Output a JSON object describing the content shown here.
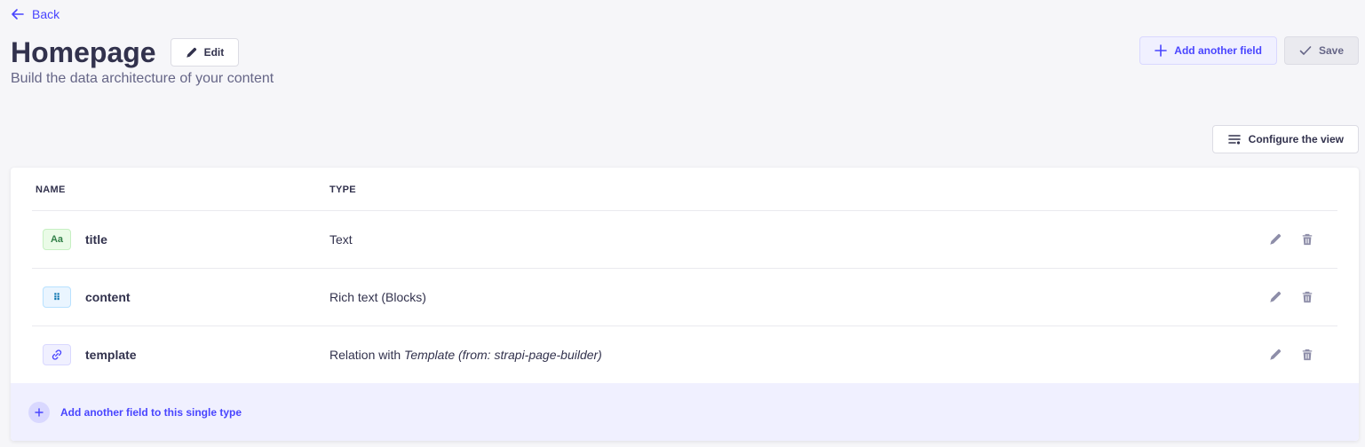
{
  "nav": {
    "back_label": "Back"
  },
  "header": {
    "title": "Homepage",
    "edit_label": "Edit",
    "subtitle": "Build the data architecture of your content",
    "add_field_label": "Add another field",
    "save_label": "Save",
    "configure_label": "Configure the view"
  },
  "table": {
    "columns": {
      "name": "NAME",
      "type": "TYPE"
    },
    "rows": [
      {
        "icon": "text-icon",
        "icon_glyph": "Aa",
        "name": "title",
        "type": "Text",
        "type_italic": ""
      },
      {
        "icon": "blocks-icon",
        "icon_glyph": "⠿",
        "name": "content",
        "type": "Rich text (Blocks)",
        "type_italic": ""
      },
      {
        "icon": "relation-icon",
        "icon_glyph": "",
        "name": "template",
        "type": "Relation with ",
        "type_italic": "Template (from: strapi-page-builder)"
      }
    ],
    "add_field_label": "Add another field to this single type"
  },
  "colors": {
    "accent": "#4945ff",
    "background": "#f6f6f9",
    "text": "#32324d",
    "muted": "#666687"
  }
}
